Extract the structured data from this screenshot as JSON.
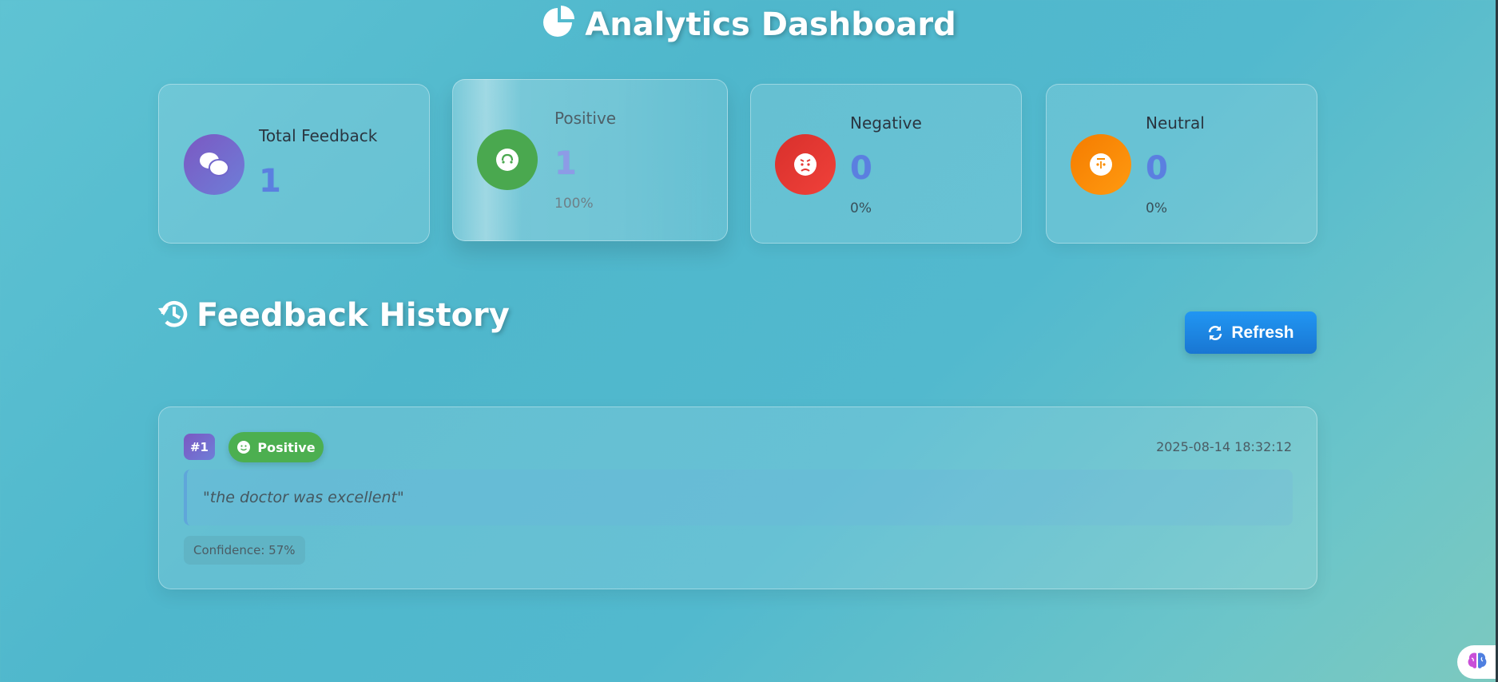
{
  "header": {
    "title": "Analytics Dashboard",
    "icon": "pie-chart-icon"
  },
  "stats": {
    "total": {
      "label": "Total Feedback",
      "value": "1",
      "icon": "comments-icon",
      "color": "#7b58c2"
    },
    "positive": {
      "label": "Positive",
      "value": "1",
      "percent": "100%",
      "icon": "smile-icon",
      "color": "#4aa84f"
    },
    "negative": {
      "label": "Negative",
      "value": "0",
      "percent": "0%",
      "icon": "angry-icon",
      "color": "#e53935"
    },
    "neutral": {
      "label": "Neutral",
      "value": "0",
      "percent": "0%",
      "icon": "neutral-face-icon",
      "color": "#fb8c00"
    }
  },
  "history": {
    "title": "Feedback History",
    "icon": "history-icon",
    "refresh_label": "Refresh",
    "refresh_icon": "sync-icon",
    "items": [
      {
        "number": "#1",
        "sentiment": "Positive",
        "sentiment_icon": "smile-icon",
        "timestamp": "2025-08-14 18:32:12",
        "text": "\"the doctor was excellent\"",
        "confidence": "Confidence: 57%"
      }
    ]
  },
  "corner_widget": {
    "icon": "brain-icon"
  },
  "colors": {
    "accent_blue": "#1e88e5",
    "positive_green": "#4caf50",
    "value_blue": "#5b7fe0"
  }
}
